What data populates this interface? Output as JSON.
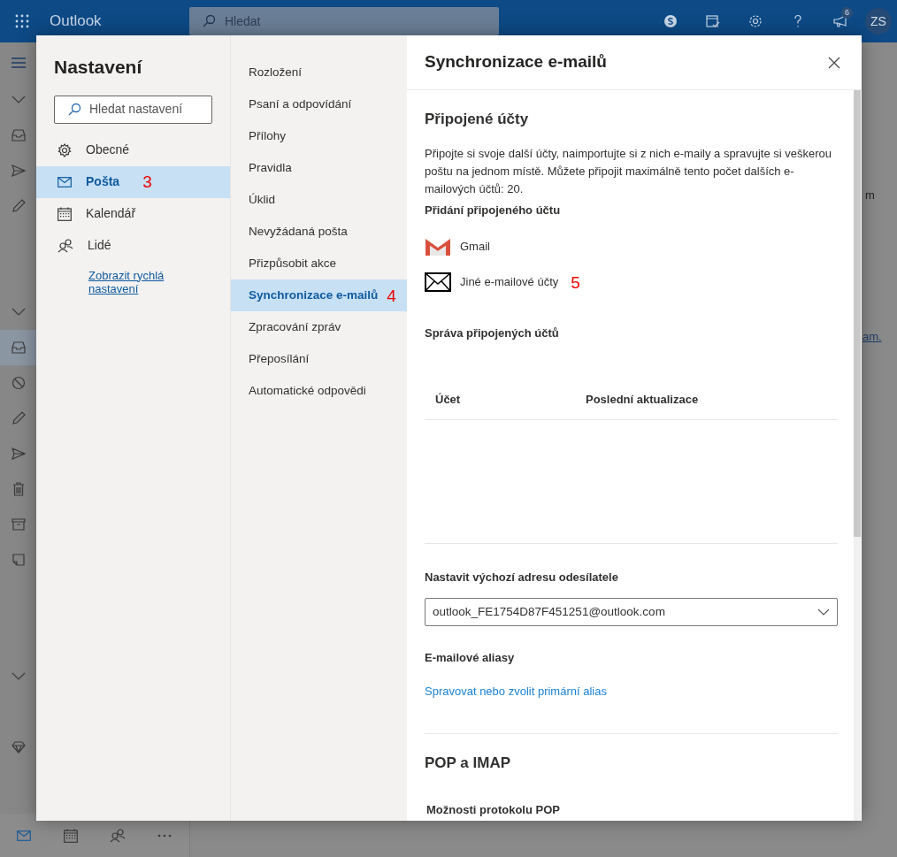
{
  "top_bar": {
    "app_title": "Outlook",
    "search": {
      "placeholder": "Hledat"
    },
    "notification_count": "6",
    "avatar_initials": "ZS"
  },
  "reading_pane_fragments": [
    "m",
    "am."
  ],
  "settings": {
    "title": "Nastavení",
    "search": {
      "placeholder": "Hledat nastavení"
    },
    "categories": [
      {
        "kind": "gear",
        "label": "Obecné",
        "selected": false
      },
      {
        "kind": "mail",
        "label": "Pošta",
        "selected": true,
        "annotation": "3"
      },
      {
        "kind": "calendar",
        "label": "Kalendář",
        "selected": false
      },
      {
        "kind": "people",
        "label": "Lidé",
        "selected": false
      }
    ],
    "quick_settings_link": "Zobrazit rychlá nastavení",
    "subcategories": [
      {
        "label": "Rozložení",
        "selected": false
      },
      {
        "label": "Psaní a odpovídání",
        "selected": false
      },
      {
        "label": "Přílohy",
        "selected": false
      },
      {
        "label": "Pravidla",
        "selected": false
      },
      {
        "label": "Úklid",
        "selected": false
      },
      {
        "label": "Nevyžádaná pošta",
        "selected": false
      },
      {
        "label": "Přizpůsobit akce",
        "selected": false
      },
      {
        "label": "Synchronizace e-mailů",
        "selected": true,
        "annotation": "4"
      },
      {
        "label": "Zpracování zpráv",
        "selected": false
      },
      {
        "label": "Přeposílání",
        "selected": false
      },
      {
        "label": "Automatické odpovědi",
        "selected": false
      }
    ]
  },
  "panel": {
    "title": "Synchronizace e-mailů",
    "section_title": "Připojené účty",
    "description": "Připojte si svoje další účty, naimportujte si z nich e-maily a spravujte si veškerou poštu na jednom místě. Můžete připojit maximálně tento počet dalších e-mailových účtů: 20.",
    "add_heading": "Přidání připojeného účtu",
    "add_options": [
      {
        "kind": "gmail",
        "label": "Gmail"
      },
      {
        "kind": "other",
        "label": "Jiné e-mailové účty",
        "annotation": "5"
      }
    ],
    "manage_heading": "Správa připojených účtů",
    "table": {
      "columns": [
        "Účet",
        "Poslední aktualizace"
      ]
    },
    "default_from_heading": "Nastavit výchozí adresu odesílatele",
    "default_from_value": "outlook_FE1754D87F451251@outlook.com",
    "aliases_heading": "E-mailové aliasy",
    "aliases_link": "Spravovat nebo zvolit primární alias",
    "pop_imap_title": "POP a IMAP",
    "pop_options_heading": "Možnosti protokolu POP"
  }
}
